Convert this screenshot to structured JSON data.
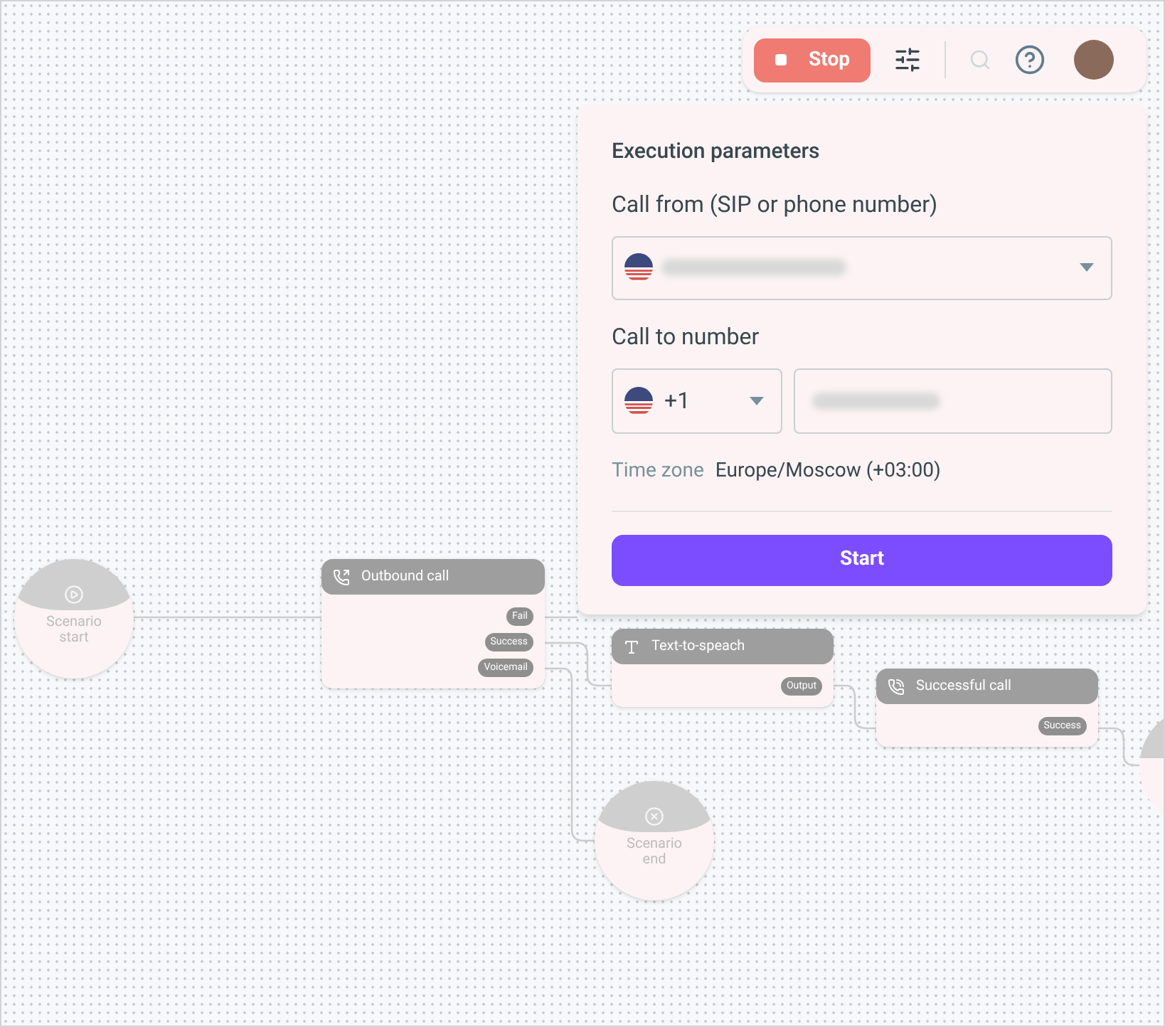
{
  "toolbar": {
    "stop_button": "Stop"
  },
  "execution_panel": {
    "title": "Execution parameters",
    "call_from_label": "Call from (SIP or phone number)",
    "call_to_label": "Call to number",
    "country_code": "+1",
    "time_zone_label": "Time zone",
    "time_zone_value": "Europe/Moscow (+03:00)",
    "start_button": "Start"
  },
  "canvas": {
    "nodes": [
      {
        "kind": "start",
        "label": "Scenario start"
      },
      {
        "kind": "card",
        "title": "Outbound call",
        "outputs": [
          "Fail",
          "Success",
          "Voicemail"
        ]
      },
      {
        "kind": "card",
        "title": "Text-to-speach",
        "outputs": [
          "Output"
        ]
      },
      {
        "kind": "card",
        "title": "Successful call",
        "outputs": [
          "Success"
        ]
      },
      {
        "kind": "end",
        "label": "Scenario end"
      }
    ]
  }
}
